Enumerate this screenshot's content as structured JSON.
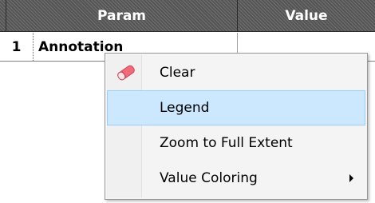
{
  "grid": {
    "columns": [
      {
        "label": "Param"
      },
      {
        "label": "Value"
      }
    ],
    "rows": [
      {
        "number": "1",
        "param": "Annotation",
        "value": ""
      }
    ]
  },
  "context_menu": {
    "items": [
      {
        "label": "Clear",
        "icon": "eraser-icon",
        "highlighted": false
      },
      {
        "label": "Legend",
        "highlighted": true
      },
      {
        "label": "Zoom to Full Extent",
        "highlighted": false
      },
      {
        "label": "Value Coloring",
        "has_submenu": true,
        "highlighted": false
      }
    ]
  },
  "colors": {
    "header_background": "#555555",
    "menu_highlight": "#cce8ff",
    "menu_highlight_border": "#99ccff",
    "eraser_pink": "#f06a78"
  }
}
